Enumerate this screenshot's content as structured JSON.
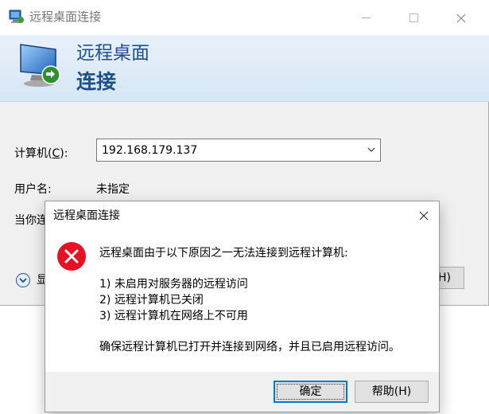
{
  "main_window": {
    "title": "远程桌面连接",
    "banner": {
      "line1": "远程桌面",
      "line2": "连接"
    },
    "computer_label_prefix": "计算机(",
    "computer_label_key": "C",
    "computer_label_suffix": "):",
    "computer_value": "192.168.179.137",
    "user_label": "用户名:",
    "user_value": "未指定",
    "prompt_label": "当你连",
    "options_label": "显",
    "help_button_partial": "H)"
  },
  "dialog": {
    "title": "远程桌面连接",
    "message": "远程桌面由于以下原因之一无法连接到远程计算机:",
    "reasons": [
      "1) 未启用对服务器的远程访问",
      "2) 远程计算机已关闭",
      "3) 远程计算机在网络上不可用"
    ],
    "hint": "确保远程计算机已打开并连接到网络，并且已启用远程访问。",
    "ok_label": "确定",
    "help_label": "帮助(H)"
  },
  "colors": {
    "banner_text": "#1c4f8c",
    "error_red": "#e81123",
    "focus_blue": "#0078d7"
  }
}
